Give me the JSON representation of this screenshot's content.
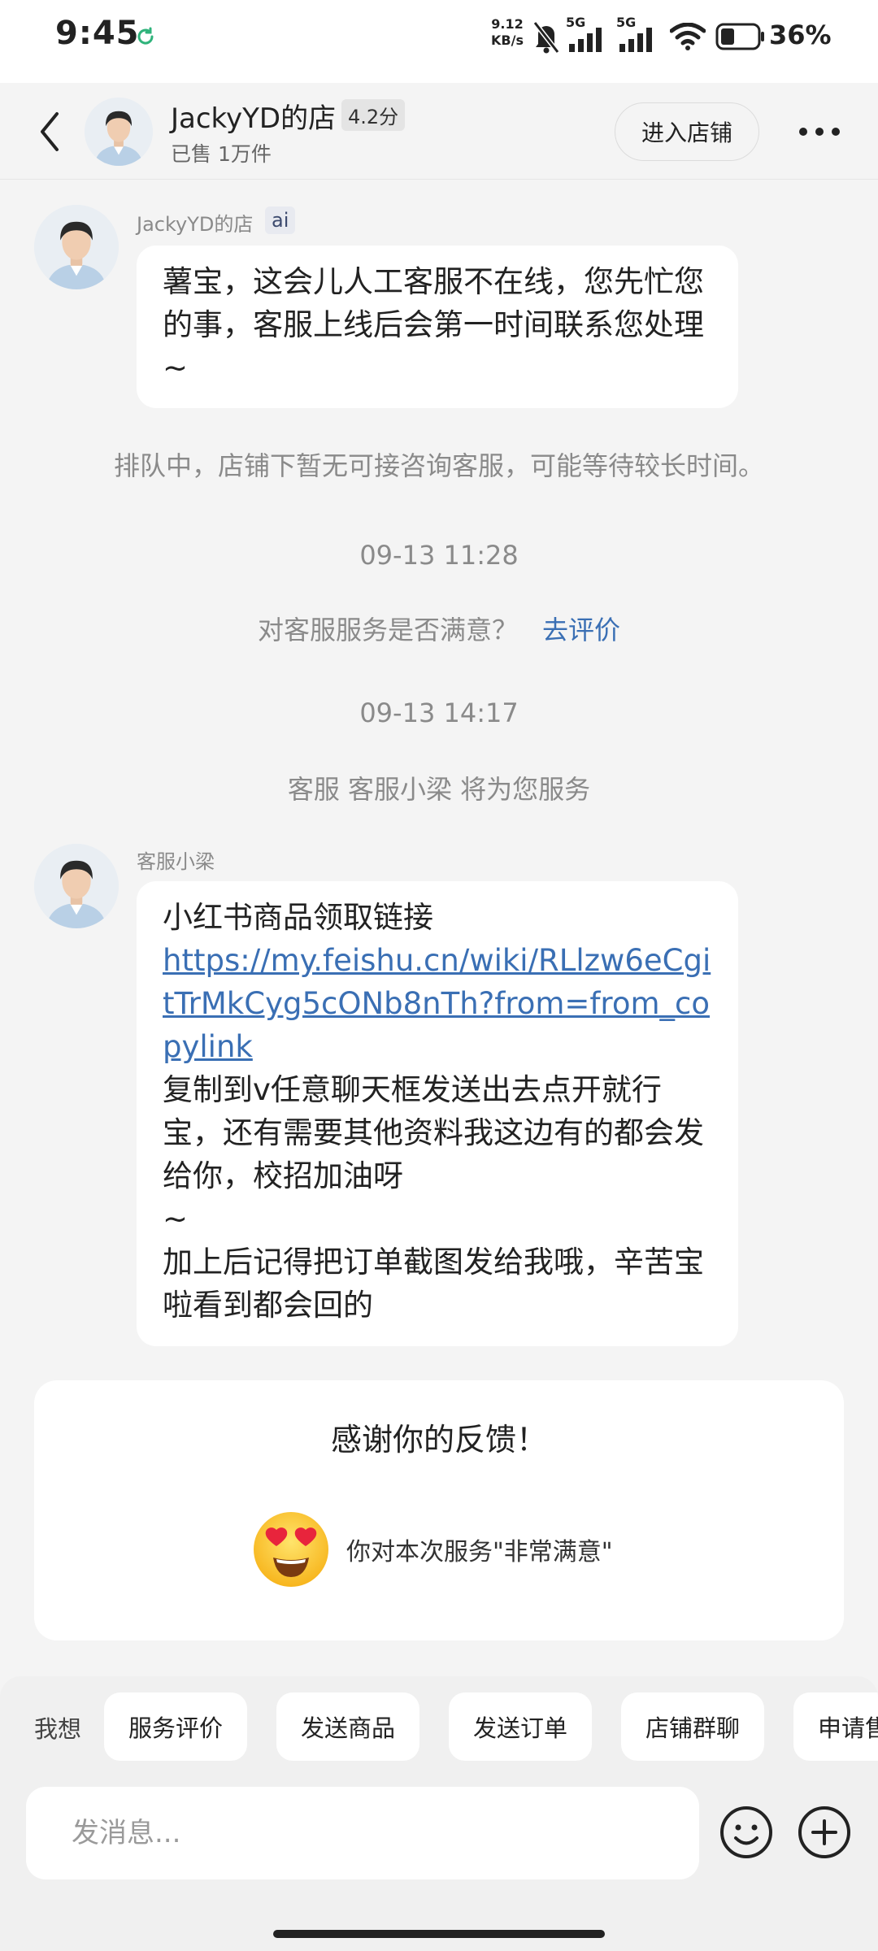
{
  "status_bar": {
    "time": "9:45",
    "net_speed_value": "9.12",
    "net_speed_unit": "KB/s",
    "signal_label_1": "5G",
    "signal_label_2": "5G",
    "battery": "36%",
    "icons": [
      "sync-icon",
      "mute-bell-icon",
      "signal-icon",
      "signal-icon",
      "wifi-icon",
      "battery-icon"
    ]
  },
  "header": {
    "shop_name": "JackyYD的店",
    "score": "4.2分",
    "sold": "已售 1万件",
    "enter_shop": "进入店铺"
  },
  "messages": [
    {
      "sender": "JackyYD的店",
      "tag": "ai",
      "text": "薯宝，这会儿人工客服不在线，您先忙您的事，客服上线后会第一时间联系您处理~"
    },
    {
      "sender": "客服小梁",
      "line1": "小红书商品领取链接",
      "link": "https://my.feishu.cn/wiki/RLlzw6eCgitTrMkCyg5cONb8nTh?from=from_copylink",
      "line2": "复制到v任意聊天框发送出去点开就行宝，还有需要其他资料我这边有的都会发给你，校招加油呀",
      "line3": "~",
      "line4": "加上后记得把订单截图发给我哦，辛苦宝啦看到都会回的"
    }
  ],
  "system": {
    "queue_notice": "排队中，店铺下暂无可接咨询客服，可能等待较长时间。",
    "time1": "09-13 11:28",
    "satisfaction_question": "对客服服务是否满意？",
    "rate_link": "去评价",
    "time2": "09-13 14:17",
    "agent_notice": "客服 客服小梁 将为您服务"
  },
  "feedback": {
    "title": "感谢你的反馈！",
    "result": "你对本次服务\"非常满意\""
  },
  "quick_actions": {
    "label": "我想",
    "items": [
      "服务评价",
      "发送商品",
      "发送订单",
      "店铺群聊",
      "申请售后"
    ]
  },
  "input": {
    "placeholder": "发消息..."
  }
}
